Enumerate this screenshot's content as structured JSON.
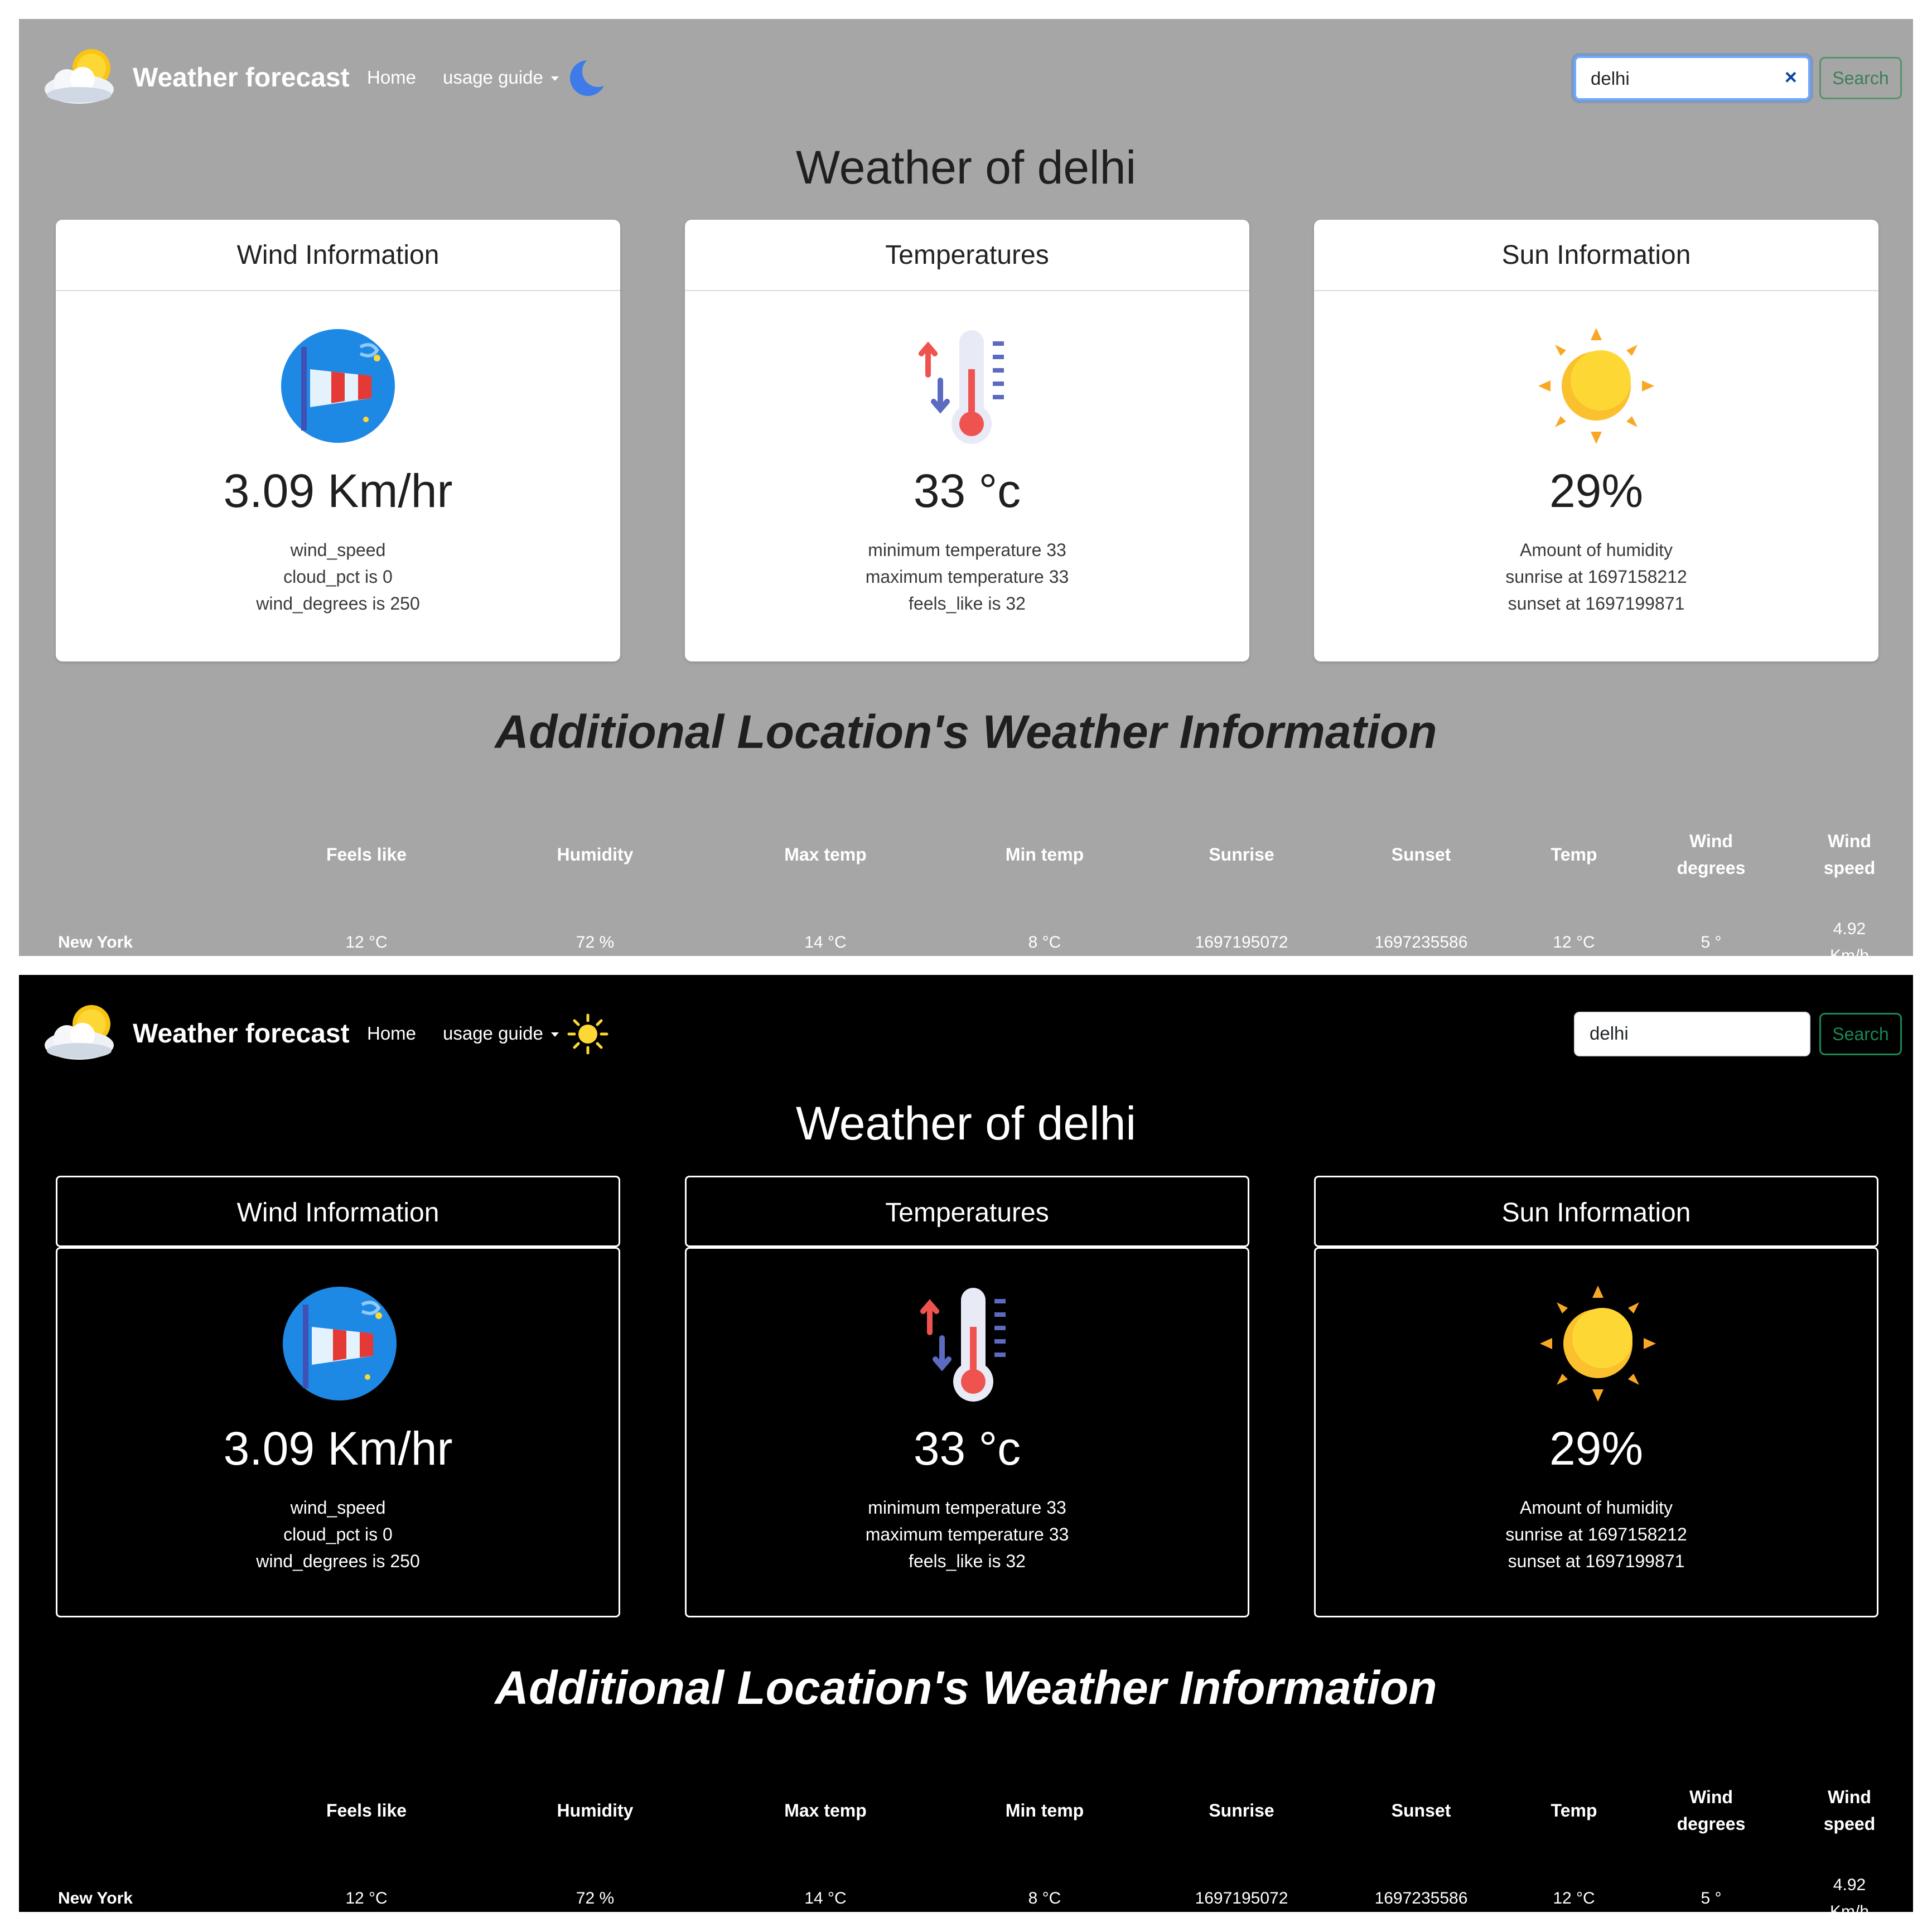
{
  "brand": "Weather forecast",
  "nav": {
    "home": "Home",
    "usage_guide": "usage guide"
  },
  "search": {
    "value": "delhi",
    "button": "Search",
    "clear": "×"
  },
  "title": "Weather of delhi",
  "cards": {
    "wind": {
      "header": "Wind Information",
      "value": "3.09 Km/hr",
      "lines": [
        "wind_speed",
        "cloud_pct is 0",
        "wind_degrees is 250"
      ]
    },
    "temp": {
      "header": "Temperatures",
      "value": "33 °c",
      "lines": [
        "minimum temperature 33",
        "maximum temperature 33",
        "feels_like is 32"
      ]
    },
    "sun": {
      "header": "Sun Information",
      "value": "29%",
      "lines": [
        "Amount of humidity",
        "sunrise at 1697158212",
        "sunset at 1697199871"
      ]
    }
  },
  "additional_title": "Additional Location's Weather Information",
  "table": {
    "headers": {
      "feels_like": "Feels like",
      "humidity": "Humidity",
      "max_temp": "Max temp",
      "min_temp": "Min temp",
      "sunrise": "Sunrise",
      "sunset": "Sunset",
      "temp": "Temp",
      "wind_degrees": [
        "Wind",
        "degrees"
      ],
      "wind_speed": [
        "Wind",
        "speed"
      ]
    },
    "row": {
      "city": "New York",
      "feels_like": "12 °C",
      "humidity": "72 %",
      "max_temp": "14 °C",
      "min_temp": "8 °C",
      "sunrise": "1697195072",
      "sunset": "1697235586",
      "temp": "12 °C",
      "wind_degrees": "5 °",
      "wind_speed": [
        "4.92",
        "Km/h"
      ]
    }
  },
  "themes": {
    "light": {
      "background": "#a6a6a6",
      "toggle_icon": "moon-icon"
    },
    "dark": {
      "background": "#000000",
      "toggle_icon": "sun-icon"
    }
  }
}
